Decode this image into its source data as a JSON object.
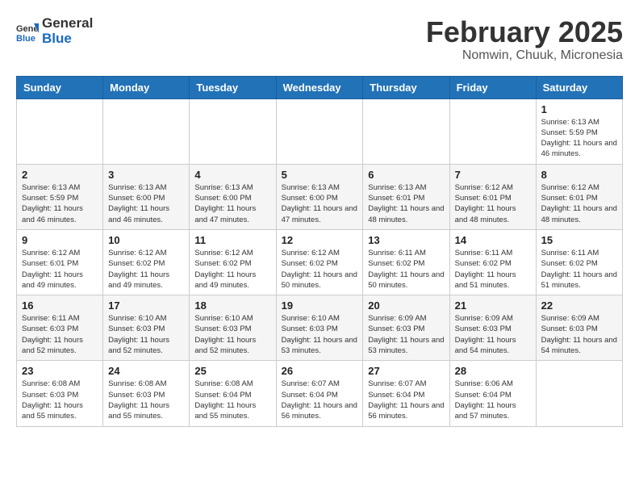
{
  "header": {
    "logo_general": "General",
    "logo_blue": "Blue",
    "title": "February 2025",
    "subtitle": "Nomwin, Chuuk, Micronesia"
  },
  "days_of_week": [
    "Sunday",
    "Monday",
    "Tuesday",
    "Wednesday",
    "Thursday",
    "Friday",
    "Saturday"
  ],
  "weeks": [
    [
      {
        "day": "",
        "info": ""
      },
      {
        "day": "",
        "info": ""
      },
      {
        "day": "",
        "info": ""
      },
      {
        "day": "",
        "info": ""
      },
      {
        "day": "",
        "info": ""
      },
      {
        "day": "",
        "info": ""
      },
      {
        "day": "1",
        "info": "Sunrise: 6:13 AM\nSunset: 5:59 PM\nDaylight: 11 hours and 46 minutes."
      }
    ],
    [
      {
        "day": "2",
        "info": "Sunrise: 6:13 AM\nSunset: 5:59 PM\nDaylight: 11 hours and 46 minutes."
      },
      {
        "day": "3",
        "info": "Sunrise: 6:13 AM\nSunset: 6:00 PM\nDaylight: 11 hours and 46 minutes."
      },
      {
        "day": "4",
        "info": "Sunrise: 6:13 AM\nSunset: 6:00 PM\nDaylight: 11 hours and 47 minutes."
      },
      {
        "day": "5",
        "info": "Sunrise: 6:13 AM\nSunset: 6:00 PM\nDaylight: 11 hours and 47 minutes."
      },
      {
        "day": "6",
        "info": "Sunrise: 6:13 AM\nSunset: 6:01 PM\nDaylight: 11 hours and 48 minutes."
      },
      {
        "day": "7",
        "info": "Sunrise: 6:12 AM\nSunset: 6:01 PM\nDaylight: 11 hours and 48 minutes."
      },
      {
        "day": "8",
        "info": "Sunrise: 6:12 AM\nSunset: 6:01 PM\nDaylight: 11 hours and 48 minutes."
      }
    ],
    [
      {
        "day": "9",
        "info": "Sunrise: 6:12 AM\nSunset: 6:01 PM\nDaylight: 11 hours and 49 minutes."
      },
      {
        "day": "10",
        "info": "Sunrise: 6:12 AM\nSunset: 6:02 PM\nDaylight: 11 hours and 49 minutes."
      },
      {
        "day": "11",
        "info": "Sunrise: 6:12 AM\nSunset: 6:02 PM\nDaylight: 11 hours and 49 minutes."
      },
      {
        "day": "12",
        "info": "Sunrise: 6:12 AM\nSunset: 6:02 PM\nDaylight: 11 hours and 50 minutes."
      },
      {
        "day": "13",
        "info": "Sunrise: 6:11 AM\nSunset: 6:02 PM\nDaylight: 11 hours and 50 minutes."
      },
      {
        "day": "14",
        "info": "Sunrise: 6:11 AM\nSunset: 6:02 PM\nDaylight: 11 hours and 51 minutes."
      },
      {
        "day": "15",
        "info": "Sunrise: 6:11 AM\nSunset: 6:02 PM\nDaylight: 11 hours and 51 minutes."
      }
    ],
    [
      {
        "day": "16",
        "info": "Sunrise: 6:11 AM\nSunset: 6:03 PM\nDaylight: 11 hours and 52 minutes."
      },
      {
        "day": "17",
        "info": "Sunrise: 6:10 AM\nSunset: 6:03 PM\nDaylight: 11 hours and 52 minutes."
      },
      {
        "day": "18",
        "info": "Sunrise: 6:10 AM\nSunset: 6:03 PM\nDaylight: 11 hours and 52 minutes."
      },
      {
        "day": "19",
        "info": "Sunrise: 6:10 AM\nSunset: 6:03 PM\nDaylight: 11 hours and 53 minutes."
      },
      {
        "day": "20",
        "info": "Sunrise: 6:09 AM\nSunset: 6:03 PM\nDaylight: 11 hours and 53 minutes."
      },
      {
        "day": "21",
        "info": "Sunrise: 6:09 AM\nSunset: 6:03 PM\nDaylight: 11 hours and 54 minutes."
      },
      {
        "day": "22",
        "info": "Sunrise: 6:09 AM\nSunset: 6:03 PM\nDaylight: 11 hours and 54 minutes."
      }
    ],
    [
      {
        "day": "23",
        "info": "Sunrise: 6:08 AM\nSunset: 6:03 PM\nDaylight: 11 hours and 55 minutes."
      },
      {
        "day": "24",
        "info": "Sunrise: 6:08 AM\nSunset: 6:03 PM\nDaylight: 11 hours and 55 minutes."
      },
      {
        "day": "25",
        "info": "Sunrise: 6:08 AM\nSunset: 6:04 PM\nDaylight: 11 hours and 55 minutes."
      },
      {
        "day": "26",
        "info": "Sunrise: 6:07 AM\nSunset: 6:04 PM\nDaylight: 11 hours and 56 minutes."
      },
      {
        "day": "27",
        "info": "Sunrise: 6:07 AM\nSunset: 6:04 PM\nDaylight: 11 hours and 56 minutes."
      },
      {
        "day": "28",
        "info": "Sunrise: 6:06 AM\nSunset: 6:04 PM\nDaylight: 11 hours and 57 minutes."
      },
      {
        "day": "",
        "info": ""
      }
    ]
  ]
}
